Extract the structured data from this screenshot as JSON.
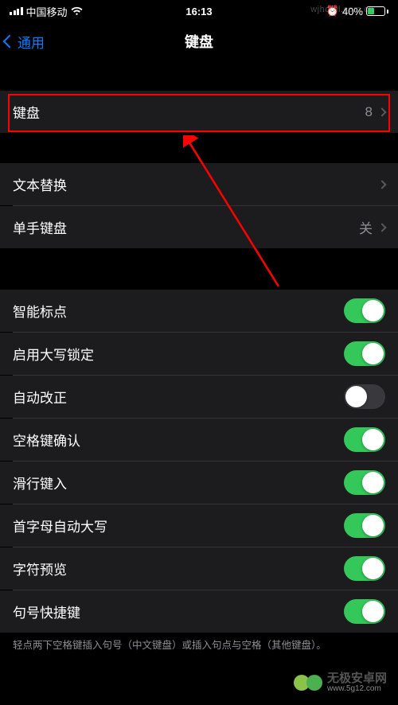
{
  "status_bar": {
    "carrier": "中国移动",
    "time": "16:13",
    "battery_pct": "40%"
  },
  "nav": {
    "back_label": "通用",
    "title": "键盘"
  },
  "keyboards_row": {
    "label": "键盘",
    "count": "8"
  },
  "text_sub_row": {
    "label": "文本替换"
  },
  "one_hand_row": {
    "label": "单手键盘",
    "value": "关"
  },
  "toggles": {
    "smart_punct": {
      "label": "智能标点",
      "on": true
    },
    "caps_lock": {
      "label": "启用大写锁定",
      "on": true
    },
    "auto_correct": {
      "label": "自动改正",
      "on": false
    },
    "space_confirm": {
      "label": "空格键确认",
      "on": true
    },
    "slide_input": {
      "label": "滑行键入",
      "on": true
    },
    "auto_caps": {
      "label": "首字母自动大写",
      "on": true
    },
    "char_preview": {
      "label": "字符预览",
      "on": true
    },
    "period_short": {
      "label": "句号快捷键",
      "on": true
    }
  },
  "footer_hint": "轻点两下空格键插入句号（中文键盘）或插入句点与空格（其他键盘）。",
  "watermark": {
    "url": "wjhotel.com.cn",
    "brand": "无极安卓网",
    "sub": "www.5g12.com"
  },
  "annotation": {
    "highlight_color": "#ff0000"
  }
}
